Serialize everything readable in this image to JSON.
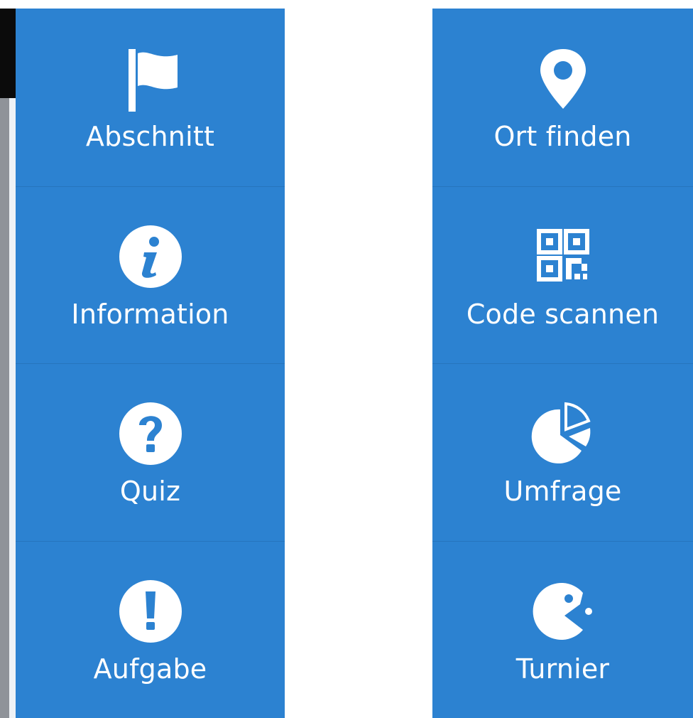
{
  "panel": {
    "left_column": [
      {
        "id": "abschnitt",
        "label": "Abschnitt",
        "icon": "flag-icon"
      },
      {
        "id": "information",
        "label": "Information",
        "icon": "info-circle-icon"
      },
      {
        "id": "quiz",
        "label": "Quiz",
        "icon": "question-circle-icon"
      },
      {
        "id": "aufgabe",
        "label": "Aufgabe",
        "icon": "exclamation-circle-icon"
      }
    ],
    "right_column": [
      {
        "id": "ort-finden",
        "label": "Ort finden",
        "icon": "map-marker-icon"
      },
      {
        "id": "code-scannen",
        "label": "Code scannen",
        "icon": "qr-code-icon"
      },
      {
        "id": "umfrage",
        "label": "Umfrage",
        "icon": "pie-chart-icon"
      },
      {
        "id": "turnier",
        "label": "Turnier",
        "icon": "pacman-icon"
      }
    ]
  },
  "colors": {
    "tile_background": "#2c82d1",
    "tile_divider": "#2675bd",
    "text": "#ffffff",
    "page_background": "#ffffff"
  }
}
